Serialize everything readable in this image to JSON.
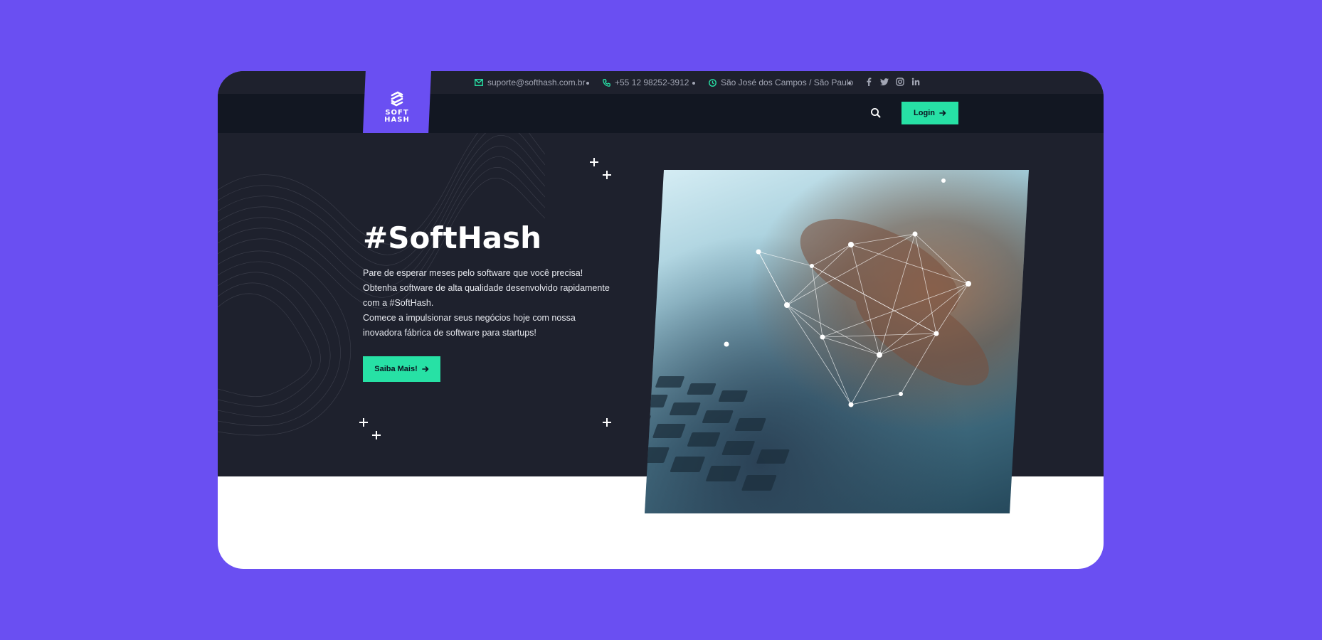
{
  "topbar": {
    "email": "suporte@softhash.com.br",
    "phone": "+55 12 98252-3912",
    "location": "São José dos Campos / São Paulo",
    "social": [
      "facebook-icon",
      "twitter-icon",
      "instagram-icon",
      "linkedin-icon"
    ]
  },
  "logo": {
    "text": "SOFT\nHASH"
  },
  "nav": {
    "login_label": "Login"
  },
  "hero": {
    "title": "#SoftHash",
    "lines": [
      "Pare de esperar meses pelo software que você precisa!",
      "Obtenha software de alta qualidade desenvolvido rapidamente com a #SoftHash.",
      "Comece a impulsionar seus negócios hoje com nossa inovadora fábrica de software para startups!"
    ],
    "cta_label": "Saiba Mais!"
  },
  "colors": {
    "brand_purple": "#6a4ff2",
    "accent_green": "#27e1a5",
    "dark_bg": "#1e212d",
    "nav_bg": "#121722"
  }
}
